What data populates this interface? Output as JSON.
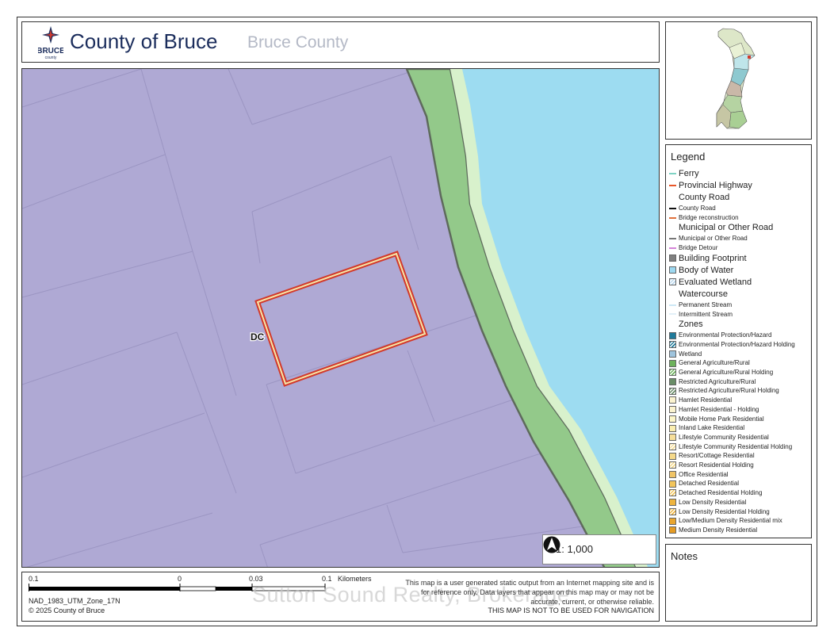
{
  "header": {
    "logo_text": "BRUCE",
    "logo_sub": "county",
    "title": "County of Bruce",
    "subtitle": "Bruce County"
  },
  "map": {
    "parcel_label": "DC",
    "scale_text": "1: 1,000",
    "north_label": "N"
  },
  "scalebar": {
    "ticks": [
      "0.1",
      "0",
      "0.03",
      "0.1"
    ],
    "unit": "Kilometers",
    "projection": "NAD_1983_UTM_Zone_17N",
    "copyright": "© 2025 County of Bruce",
    "disclaimer": "This map is a user generated static output from an Internet mapping site and is for reference only. Data layers that appear on this map may or may not be accurate, current, or otherwise reliable.",
    "nav_note": "THIS MAP IS NOT TO BE USED FOR NAVIGATION",
    "watermark": "Sutton Sound Realty, Brokerage"
  },
  "legend": {
    "title": "Legend",
    "items": [
      {
        "label": "Ferry",
        "size": "big",
        "kind": "line",
        "color": "#7fd3c4"
      },
      {
        "label": "Provincial Highway",
        "size": "big",
        "kind": "line",
        "color": "#e8572a"
      },
      {
        "label": "County Road",
        "size": "hdr",
        "kind": "none",
        "color": ""
      },
      {
        "label": "County Road",
        "size": "sm",
        "kind": "line",
        "color": "#111111"
      },
      {
        "label": "Bridge reconstruction",
        "size": "sm",
        "kind": "line",
        "color": "#e0703c"
      },
      {
        "label": "Municipal or Other Road",
        "size": "hdr",
        "kind": "none",
        "color": ""
      },
      {
        "label": "Municipal or Other Road",
        "size": "sm",
        "kind": "line",
        "color": "#777777"
      },
      {
        "label": "Bridge Detour",
        "size": "sm",
        "kind": "line",
        "color": "#d483d8"
      },
      {
        "label": "Building Footprint",
        "size": "big",
        "kind": "fill",
        "color": "#7f7f7f"
      },
      {
        "label": "Body of Water",
        "size": "big",
        "kind": "fill",
        "color": "#9dd8f0"
      },
      {
        "label": "Evaluated Wetland",
        "size": "big",
        "kind": "hatch",
        "color": "#bcd9ee"
      },
      {
        "label": "Watercourse",
        "size": "hdr",
        "kind": "none",
        "color": ""
      },
      {
        "label": "Permanent Stream",
        "size": "sm",
        "kind": "line",
        "color": "#cde8f5"
      },
      {
        "label": "Intermittent Stream",
        "size": "sm",
        "kind": "line",
        "color": "#e2f0f8"
      },
      {
        "label": "Zones",
        "size": "hdr",
        "kind": "none",
        "color": ""
      },
      {
        "label": "Environmental Protection/Hazard",
        "size": "sm",
        "kind": "fill",
        "color": "#1f7a9a"
      },
      {
        "label": "Environmental Protection/Hazard Holding",
        "size": "sm",
        "kind": "hatch",
        "color": "#1f7a9a"
      },
      {
        "label": "Wetland",
        "size": "sm",
        "kind": "fill",
        "color": "#9ec3dc"
      },
      {
        "label": "General Agriculture/Rural",
        "size": "sm",
        "kind": "fill",
        "color": "#6db25c"
      },
      {
        "label": "General Agriculture/Rural Holding",
        "size": "sm",
        "kind": "hatch",
        "color": "#6db25c"
      },
      {
        "label": "Restricted Agriculture/Rural",
        "size": "sm",
        "kind": "fill",
        "color": "#6a8e68"
      },
      {
        "label": "Restricted Agriculture/Rural Holding",
        "size": "sm",
        "kind": "hatch",
        "color": "#6a8e68"
      },
      {
        "label": "Hamlet Residential",
        "size": "sm",
        "kind": "fill",
        "color": "#fbf3cf"
      },
      {
        "label": "Hamlet Residential - Holding",
        "size": "sm",
        "kind": "fill",
        "color": "#fbf3cf"
      },
      {
        "label": "Mobile Home Park Residential",
        "size": "sm",
        "kind": "fill",
        "color": "#fdf6c9"
      },
      {
        "label": "Inland Lake Residential",
        "size": "sm",
        "kind": "fill",
        "color": "#fbeeb0"
      },
      {
        "label": "Lifestyle Community Residential",
        "size": "sm",
        "kind": "fill",
        "color": "#f7df9a"
      },
      {
        "label": "Lifestyle Community Residential Holding",
        "size": "sm",
        "kind": "hatch",
        "color": "#f7df9a"
      },
      {
        "label": "Resort/Cottage Residential",
        "size": "sm",
        "kind": "fill",
        "color": "#f5d98a"
      },
      {
        "label": "Resort Residential Holding",
        "size": "sm",
        "kind": "hatch",
        "color": "#f5d98a"
      },
      {
        "label": "Office Residential",
        "size": "sm",
        "kind": "fill",
        "color": "#f0c466"
      },
      {
        "label": "Detached Residential",
        "size": "sm",
        "kind": "fill",
        "color": "#f2c55c"
      },
      {
        "label": "Detached Residential Holding",
        "size": "sm",
        "kind": "hatch",
        "color": "#f2c55c"
      },
      {
        "label": "Low Density Residential",
        "size": "sm",
        "kind": "fill",
        "color": "#eeb43e"
      },
      {
        "label": "Low Density Residential Holding",
        "size": "sm",
        "kind": "hatch",
        "color": "#eeb43e"
      },
      {
        "label": "Low/Medium Density Residential mix",
        "size": "sm",
        "kind": "fill",
        "color": "#e9a52e"
      },
      {
        "label": "Medium Density Residential",
        "size": "sm",
        "kind": "fill",
        "color": "#e59b22"
      }
    ]
  },
  "notes": {
    "title": "Notes"
  }
}
